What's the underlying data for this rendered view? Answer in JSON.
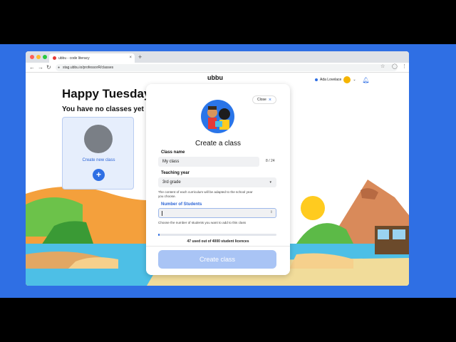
{
  "browser": {
    "tab_title": "ubbu - code literacy",
    "tab_close": "×",
    "new_tab": "+",
    "url": "stag.ubbu.io/professorR/classes"
  },
  "header": {
    "logo": "ubbu",
    "user_name": "Ada Lovelace"
  },
  "main": {
    "greeting": "Happy Tuesday",
    "no_classes": "You have no classes yet",
    "create_new_label": "Create new class",
    "plus_label": "+"
  },
  "modal": {
    "close_label": "Close",
    "close_icon": "×",
    "title": "Create a class",
    "class_name_label": "Class name",
    "class_name_value": "My class",
    "class_name_counter": "8 / 24",
    "teaching_year_label": "Teaching year",
    "teaching_year_value": "3rd grade",
    "teaching_year_hint": "The content of each curriculum will be adapted to the school year you choose.",
    "students_label": "Number of Students",
    "students_hint": "Choose the number of students you want to add to this class",
    "licence_text": "47 used out of 4000 student licences",
    "licence_fraction": 0.012,
    "create_button": "Create class"
  },
  "colors": {
    "accent": "#2f6fe4",
    "button_disabled": "#a9c4f5",
    "frame": "#2f6fe4"
  }
}
